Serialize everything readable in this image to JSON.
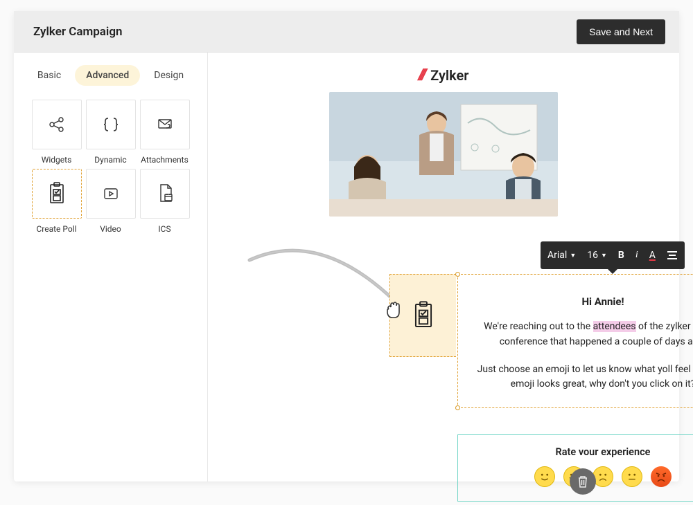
{
  "header": {
    "title": "Zylker Campaign",
    "save_label": "Save and Next"
  },
  "tabs": {
    "basic": "Basic",
    "advanced": "Advanced",
    "design": "Design",
    "active": "Advanced"
  },
  "sidebar_items": [
    {
      "label": "Widgets",
      "icon": "share-icon"
    },
    {
      "label": "Dynamic",
      "icon": "braces-icon"
    },
    {
      "label": "Attachments",
      "icon": "attachment-icon"
    },
    {
      "label": "Create Poll",
      "icon": "poll-icon"
    },
    {
      "label": "Video",
      "icon": "video-icon"
    },
    {
      "label": "ICS",
      "icon": "ics-icon"
    }
  ],
  "brand": {
    "name": "Zylker"
  },
  "toolbar": {
    "font": "Arial",
    "size": "16"
  },
  "text_block": {
    "greeting": "Hi Annie!",
    "p1_before": "We're reaching out to the ",
    "p1_highlight": "attendees",
    "p1_after": " of the zylker annual conference that happened a couple of days ago.",
    "p2": "Just choose an emoji to let us know what yoll feel The first emoji looks great, why don't you click on it?"
  },
  "poll": {
    "title": "Rate vour experience",
    "emojis": [
      "smile",
      "grin",
      "frown",
      "neutral",
      "angry"
    ]
  }
}
